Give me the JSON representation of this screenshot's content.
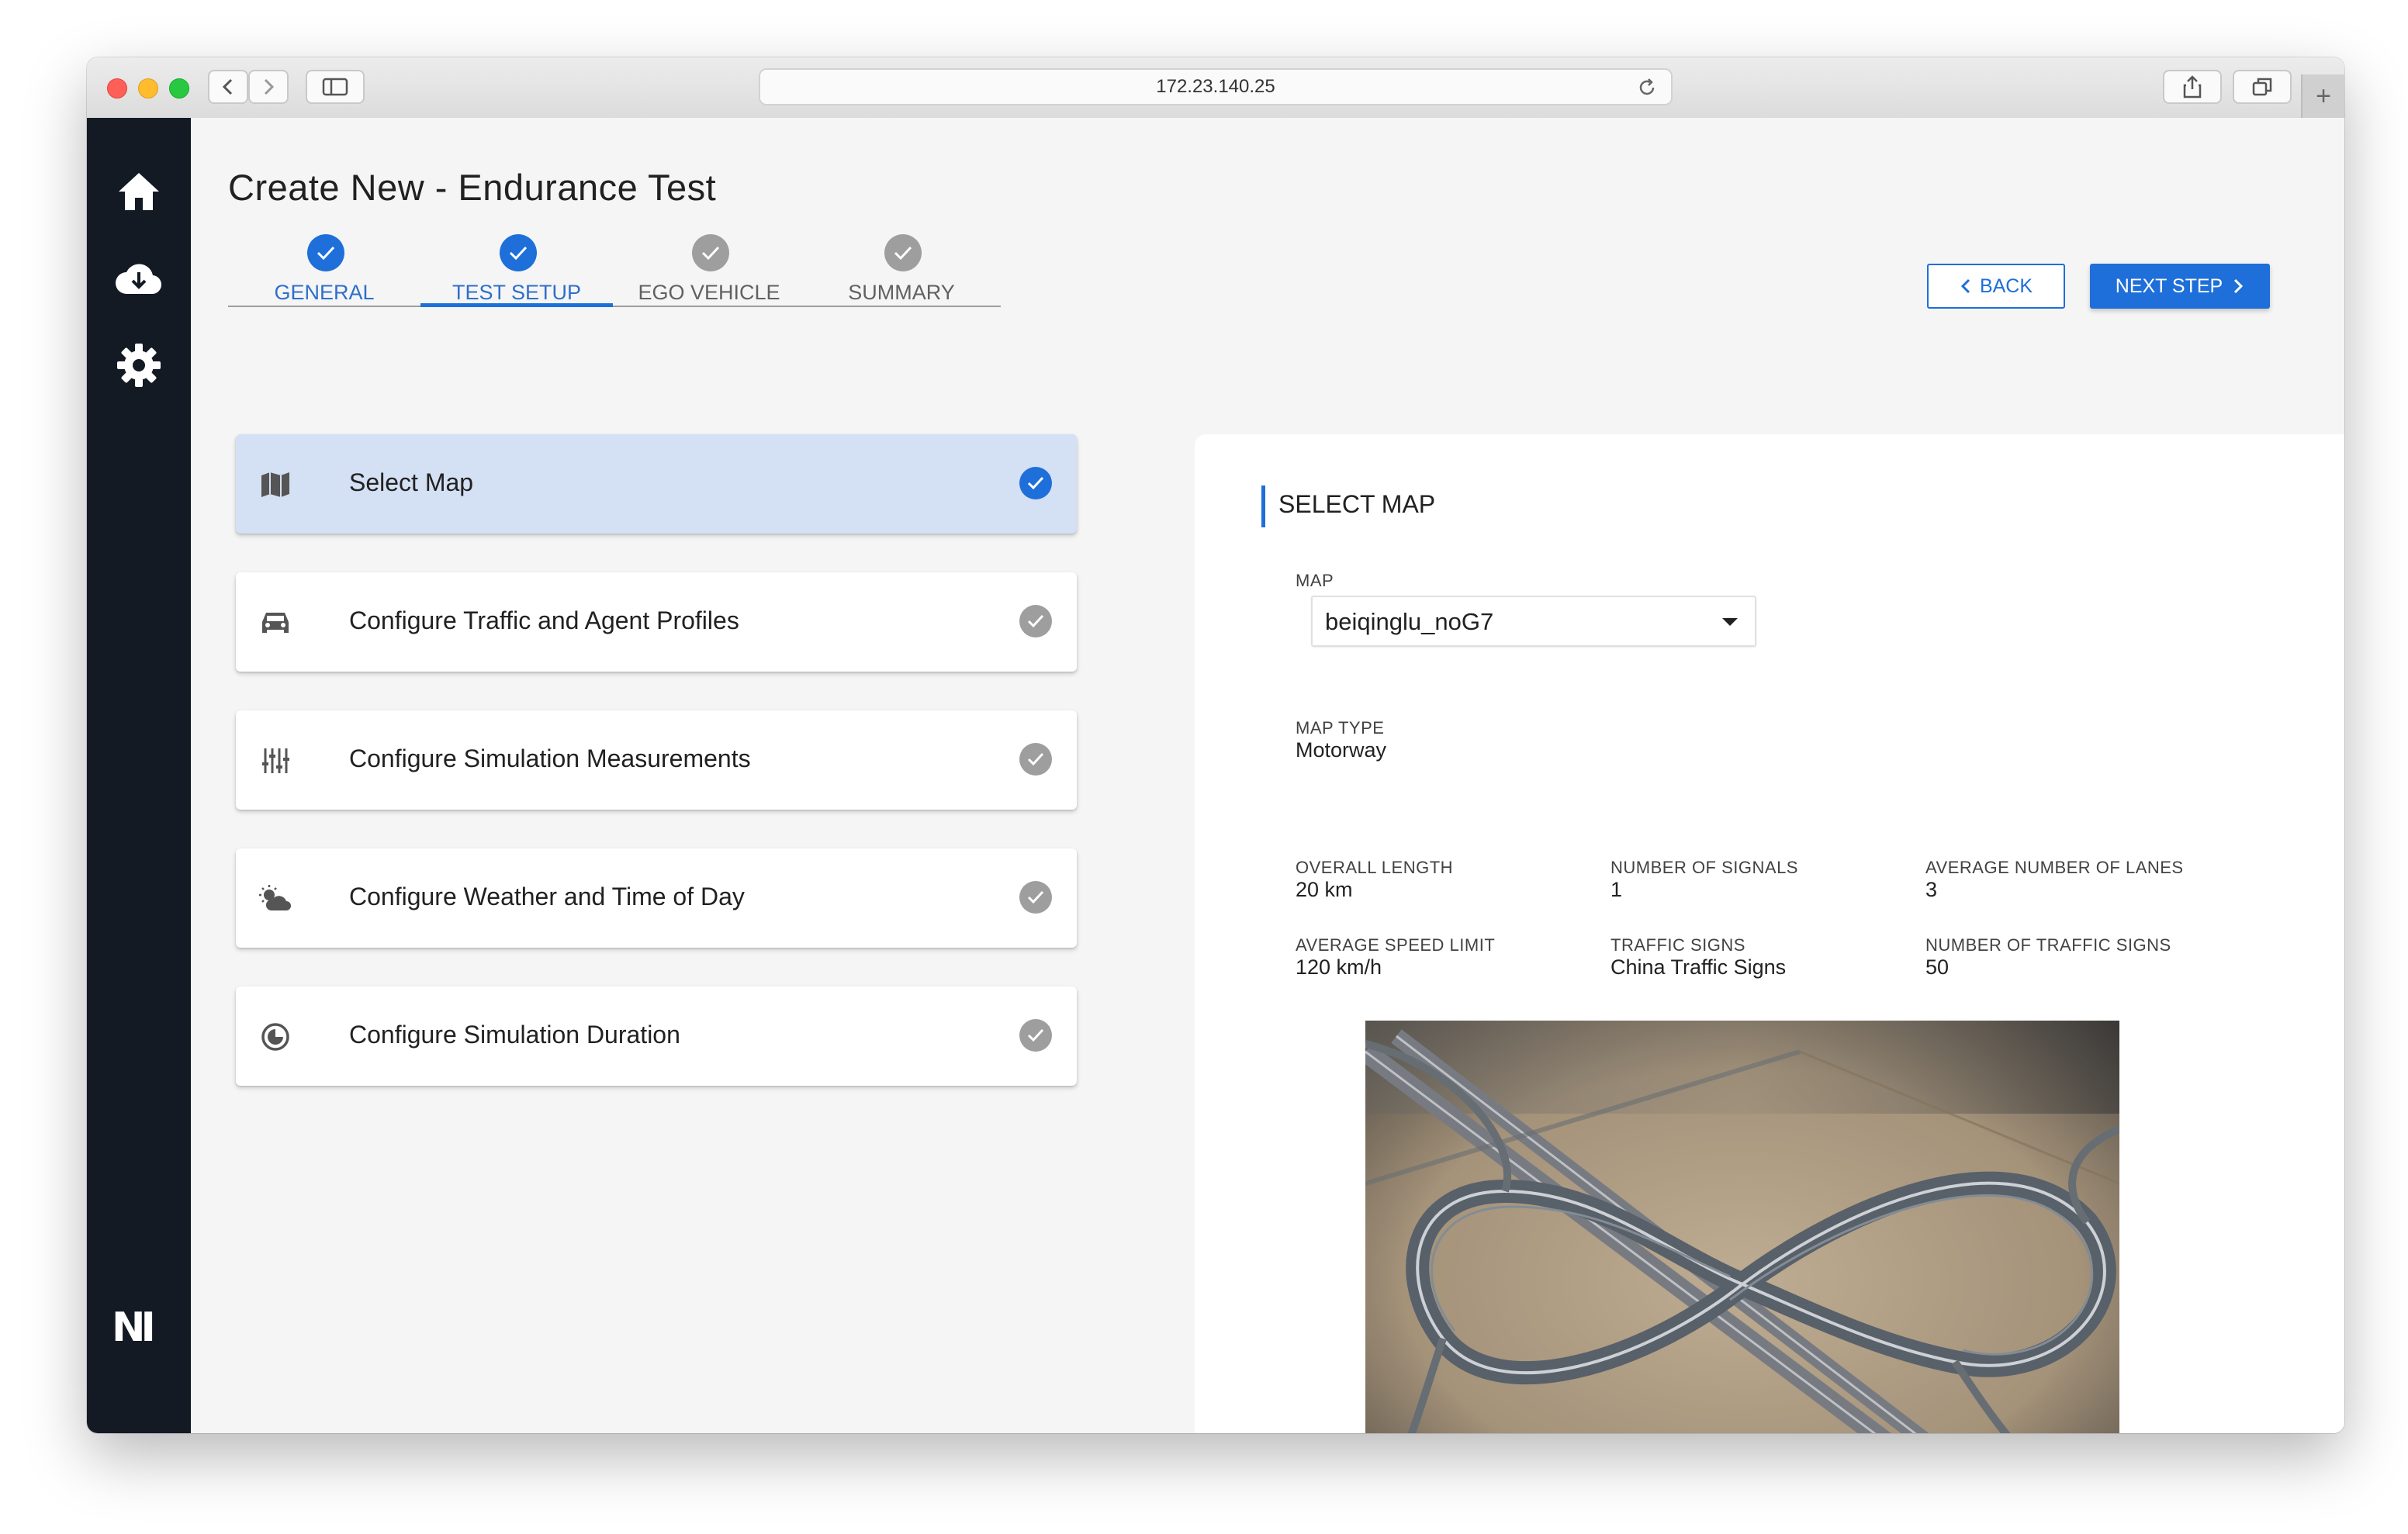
{
  "browser": {
    "url": "172.23.140.25"
  },
  "sidebar": {
    "nav_icons": [
      "home-icon",
      "cloud-download-icon",
      "gear-icon"
    ],
    "logo_text": "NI"
  },
  "page": {
    "title": "Create New - Endurance Test"
  },
  "stepper": {
    "steps": [
      {
        "label": "GENERAL",
        "state": "done"
      },
      {
        "label": "TEST SETUP",
        "state": "active"
      },
      {
        "label": "EGO VEHICLE",
        "state": "pending"
      },
      {
        "label": "SUMMARY",
        "state": "pending"
      }
    ]
  },
  "actions": {
    "back_label": "BACK",
    "next_label": "NEXT STEP"
  },
  "tasks": [
    {
      "label": "Select Map",
      "icon": "map-icon",
      "selected": true,
      "status": "complete-blue"
    },
    {
      "label": "Configure Traffic and Agent Profiles",
      "icon": "car-icon",
      "selected": false,
      "status": "complete-grey"
    },
    {
      "label": "Configure Simulation Measurements",
      "icon": "measurements-icon",
      "selected": false,
      "status": "complete-grey"
    },
    {
      "label": "Configure Weather and Time of Day",
      "icon": "weather-icon",
      "selected": false,
      "status": "complete-grey"
    },
    {
      "label": "Configure Simulation Duration",
      "icon": "duration-icon",
      "selected": false,
      "status": "complete-grey"
    }
  ],
  "panel": {
    "title": "SELECT MAP",
    "map_label": "MAP",
    "map_value": "beiqinglu_noG7",
    "map_type_label": "MAP TYPE",
    "map_type_value": "Motorway",
    "stats": [
      {
        "label": "OVERALL LENGTH",
        "value": "20 km"
      },
      {
        "label": "NUMBER OF SIGNALS",
        "value": "1"
      },
      {
        "label": "AVERAGE NUMBER OF LANES",
        "value": "3"
      },
      {
        "label": "AVERAGE SPEED LIMIT",
        "value": "120 km/h"
      },
      {
        "label": "TRAFFIC SIGNS",
        "value": "China Traffic Signs"
      },
      {
        "label": "NUMBER OF TRAFFIC SIGNS",
        "value": "50"
      }
    ]
  },
  "colors": {
    "accent": "#1e6fd9",
    "sidebar": "#131a24",
    "selected_row": "#d4e0f3",
    "inactive": "#9e9e9e"
  }
}
